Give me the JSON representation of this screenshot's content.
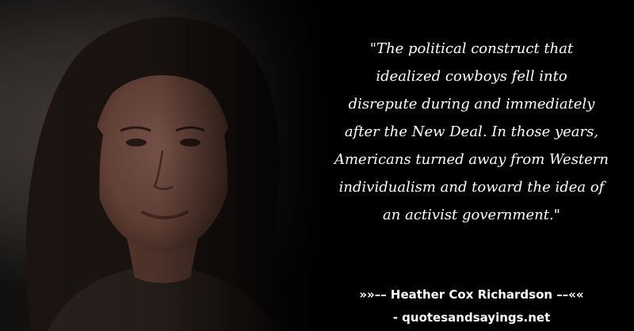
{
  "quote": {
    "lines": [
      "\"The political construct that",
      "idealized cowboys fell into",
      "disrepute during and immediately",
      "after the New Deal. In those years,",
      "Americans turned away from Western",
      "individualism and toward the idea of",
      "an activist government.\""
    ]
  },
  "attribution": {
    "text": "»»–– Heather Cox Richardson ––««"
  },
  "site": {
    "text": "- quotesandsayings.net"
  },
  "colors": {
    "background": "#000000",
    "text": "#ffffff",
    "skin": "#7a5548",
    "hair": "#1c1512"
  }
}
